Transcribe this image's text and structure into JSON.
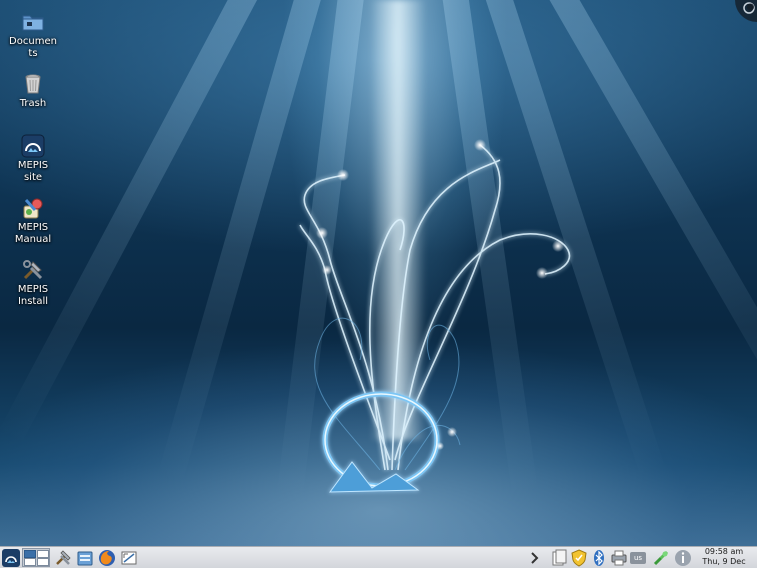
{
  "desktop": {
    "icons": [
      {
        "label": "Documen\nts",
        "icon": "folder-icon"
      },
      {
        "label": "Trash",
        "icon": "trash-icon"
      },
      {
        "label": "MEPIS\nsite",
        "icon": "mepis-site-icon"
      },
      {
        "label": "MEPIS\nManual",
        "icon": "mepis-manual-icon"
      },
      {
        "label": "MEPIS\nInstall",
        "icon": "mepis-install-icon"
      }
    ]
  },
  "panel": {
    "launchers": [
      "mepis-menu-icon",
      "pager",
      "tools-icon",
      "file-manager-icon",
      "firefox-icon",
      "screenshot-icon"
    ],
    "tray": [
      "expand-arrow-icon",
      "clipboard-icon",
      "shield-icon",
      "bluetooth-icon",
      "printer-icon",
      "us",
      "network-icon",
      "info-icon"
    ],
    "keyboard_layout": "us",
    "clock": {
      "time": "09:58 am",
      "date": "Thu, 9 Dec"
    }
  },
  "colors": {
    "panel_bg": "#dfe2e6",
    "desktop_deep": "#0a2842",
    "accent": "#3a6fa8"
  }
}
